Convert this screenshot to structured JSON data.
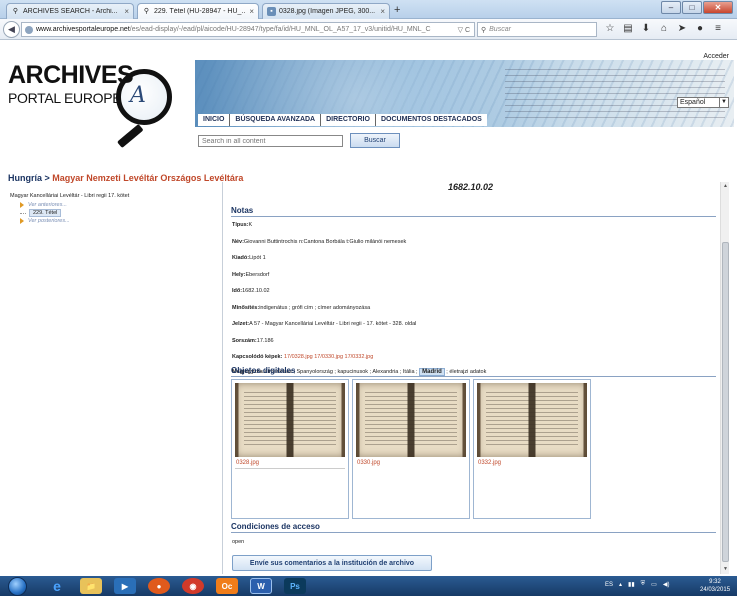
{
  "browser": {
    "tabs": [
      {
        "title": "ARCHIVES SEARCH - Archi...",
        "active": false
      },
      {
        "title": "229. Tétel (HU-28947 - HU_...",
        "active": true
      },
      {
        "title": "0328.jpg (Imagen JPEG, 300...",
        "active": false
      }
    ],
    "newtab_label": "+",
    "url_domain": "www.archivesportaleurope.net",
    "url_path": "/es/ead-display/-/ead/pl/aicode/HU-28947/type/fa/id/HU_MNL_OL_A57_17_v3/unitid/HU_MNL_C",
    "url_tools": "▽ C",
    "search_placeholder": "Buscar"
  },
  "site": {
    "logo_line1": "ARCHIVES",
    "logo_line2": "PORTAL EUROPE",
    "logo_mono": "A",
    "acceder": "Acceder",
    "language": "Español",
    "menu": [
      "INICIO",
      "BÚSQUEDA AVANZADA",
      "DIRECTORIO",
      "DOCUMENTOS DESTACADOS"
    ],
    "search_placeholder": "Search in all content",
    "search_button": "Buscar"
  },
  "breadcrumb": {
    "country": "Hungría",
    "separator": " > ",
    "institution": "Magyar Nemzeti Levéltár Országos Levéltára"
  },
  "tree": {
    "root": "Magyar Kancelláriai Levéltár - Libri regii 17. kötet",
    "prev": "Ver anteriores...",
    "current": "229. Tétel",
    "next": "Ver posteriores..."
  },
  "record": {
    "date_heading": "1682.10.02",
    "notas_heading": "Notas",
    "fields": [
      {
        "label": "Típus:",
        "value": "K"
      },
      {
        "label": "Név:",
        "value": "Giovanni Buttintrochis n:Cantona Borbála t:Giulio milánói nemesek"
      },
      {
        "label": "Kiadó:",
        "value": "Lipót 1"
      },
      {
        "label": "Hely:",
        "value": "Ebersdorf"
      },
      {
        "label": "Idő:",
        "value": "1682.10.02"
      },
      {
        "label": "Minősítés:",
        "value": "indigenátus ; grófi cím ; címer adományozása"
      },
      {
        "label": "Jelzet:",
        "value": "A 57 - Magyar Kancelláriai Levéltár - Libri regii - 17. kötet - 328. oldal"
      },
      {
        "label": "Sorszám:",
        "value": "17.186"
      }
    ],
    "kapcsolodo_label": "Kapcsolódó képek:",
    "kapcsolodo_links": [
      "17/0328.jpg",
      "17/0330.jpg",
      "17/0332.jpg"
    ],
    "megjegyzes_label": "Megjegyzés:",
    "megjegyzes_before": "címerleírás ; Spanyolország ; kapucinusok ; Alexandria ; Itália ; ",
    "megjegyzes_highlight": "Madrid",
    "megjegyzes_after": " ; életrajzi adatok",
    "objetos_heading": "Objetos digitales",
    "thumbnails": [
      "0328.jpg",
      "0330.jpg",
      "0332.jpg"
    ],
    "acceso_heading": "Condiciones de acceso",
    "acceso_value": "open",
    "comment_button": "Envíe sus comentarios a la institución de archivo"
  },
  "taskbar": {
    "apps": [
      "e",
      "📁",
      "▶",
      "●",
      "◉",
      "Oc",
      "W",
      "Ps"
    ],
    "lang": "ES",
    "time": "9:32",
    "date": "24/03/2015"
  },
  "colors": {
    "accent_link": "#c0482a",
    "heading_blue": "#1b3462"
  }
}
